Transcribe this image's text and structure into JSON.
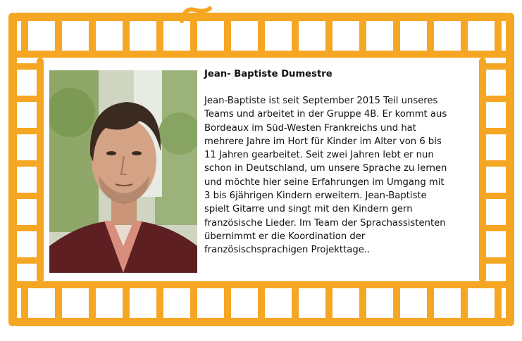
{
  "profile": {
    "name": "Jean- Baptiste Dumestre",
    "bio_lines": [
      "Jean-Baptiste ist seit September 2015 Teil unseres",
      "Teams und arbeitet in der Gruppe 4B. Er kommt aus",
      "Bordeaux im Süd-Westen Frankreichs und hat",
      "mehrere Jahre im Hort für Kinder im Alter von 6 bis",
      "11 Jahren gearbeitet.  Seit zwei Jahren lebt er nun",
      "schon in Deutschland, um unsere Sprache zu lernen",
      "und möchte hier seine Erfahrungen im Umgang mit",
      "3 bis 6jährigen Kindern erweitern.  Jean-Baptiste",
      "spielt Gitarre und singt mit den Kindern gern",
      "französische Lieder. Im Team der Sprachassistenten",
      "übernimmt er die Koordination der",
      "französischsprachigen Projekttage.."
    ]
  },
  "colors": {
    "frame": "#f5a623",
    "background": "#ffffff",
    "text": "#111111"
  }
}
